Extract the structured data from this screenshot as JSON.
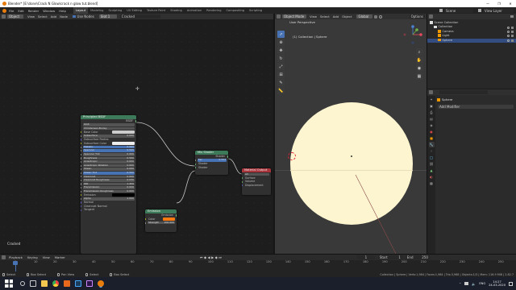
{
  "window": {
    "title": "Blender* [E:\\done\\Crack N Glow\\crack n glow tut.blend]",
    "controls": [
      "—",
      "❐",
      "✕"
    ]
  },
  "topbar": {
    "menus": [
      "File",
      "Edit",
      "Render",
      "Window",
      "Help"
    ],
    "workspaces": [
      "Layout",
      "Modeling",
      "Sculpting",
      "UV Editing",
      "Texture Paint",
      "Shading",
      "Animation",
      "Rendering",
      "Compositing",
      "Scripting"
    ],
    "active_workspace": "Layout",
    "scene": "Scene",
    "view_layer": "View Layer"
  },
  "node_editor": {
    "header": {
      "object_mode": "Object",
      "menus": [
        "View",
        "Select",
        "Add",
        "Node"
      ],
      "use_nodes": "Use Nodes",
      "slot": "Slot 1",
      "material": "Cracked"
    },
    "footer_label": "Cracked",
    "principled": {
      "title": "Principled BSDF",
      "output": "BSDF",
      "distribution": "GGX",
      "subsurface_method": "Christensen-Burley",
      "rows": [
        {
          "label": "Base Color",
          "value": ""
        },
        {
          "label": "Subsurface",
          "value": "0.000"
        },
        {
          "label": "Subsurface Radius",
          "value": ""
        },
        {
          "label": "Subsurface Color",
          "value": ""
        },
        {
          "label": "Metallic",
          "value": "0.000"
        },
        {
          "label": "Specular",
          "value": "0.500"
        },
        {
          "label": "Specular Tint",
          "value": "0.000"
        },
        {
          "label": "Roughness",
          "value": "0.500"
        },
        {
          "label": "Anisotropic",
          "value": "0.000"
        },
        {
          "label": "Anisotropic Rotation",
          "value": "0.000"
        },
        {
          "label": "Sheen",
          "value": "0.000"
        },
        {
          "label": "Sheen Tint",
          "value": "0.500"
        },
        {
          "label": "Clearcoat",
          "value": "0.000"
        },
        {
          "label": "Clearcoat Roughness",
          "value": "0.030"
        },
        {
          "label": "IOR",
          "value": "1.450"
        },
        {
          "label": "Transmission",
          "value": "0.000"
        },
        {
          "label": "Transmission Roughness",
          "value": "0.000"
        },
        {
          "label": "Emission",
          "value": ""
        },
        {
          "label": "Alpha",
          "value": "1.000"
        },
        {
          "label": "Normal",
          "value": ""
        },
        {
          "label": "Clearcoat Normal",
          "value": ""
        },
        {
          "label": "Tangent",
          "value": ""
        }
      ]
    },
    "emission": {
      "title": "Emission",
      "output": "Emission",
      "color_label": "Color",
      "strength_label": "Strength",
      "strength_value": "200.000"
    },
    "mix": {
      "title": "Mix Shader",
      "output": "Shader",
      "fac_label": "Fac",
      "fac_value": "0.554",
      "inputs": [
        "Shader",
        "Shader"
      ]
    },
    "output": {
      "title": "Material Output",
      "target": "All",
      "inputs": [
        "Surface",
        "Volume",
        "Displacement"
      ]
    }
  },
  "viewport": {
    "header": {
      "mode": "Object Mode",
      "menus": [
        "View",
        "Select",
        "Add",
        "Object"
      ],
      "orientation": "Global",
      "options": "Options"
    },
    "overlay_title": "User Perspective",
    "overlay_subtitle": "(1) Collection | Sphere",
    "tools": [
      "cursor",
      "move",
      "rotate",
      "scale",
      "transform",
      "annotate",
      "measure"
    ]
  },
  "outliner": {
    "header_label": "Scene Collection",
    "items": [
      {
        "label": "Scene Collection",
        "indent": 0,
        "icon": "collection-icon",
        "selected": false
      },
      {
        "label": "Collection",
        "indent": 1,
        "icon": "collection-icon",
        "selected": false
      },
      {
        "label": "Camera",
        "indent": 2,
        "icon": "camera-icon",
        "selected": false
      },
      {
        "label": "Light",
        "indent": 2,
        "icon": "light-icon",
        "selected": false
      },
      {
        "label": "Sphere",
        "indent": 2,
        "icon": "mesh-icon",
        "selected": true
      }
    ]
  },
  "properties": {
    "object_name": "Sphere",
    "add_modifier": "Add Modifier"
  },
  "timeline": {
    "menus": [
      "Playback",
      "Keying",
      "View",
      "Marker"
    ],
    "start_label": "Start",
    "start_value": "1",
    "end_label": "End",
    "end_value": "250",
    "current_frame": "1",
    "ticks": [
      "0",
      "10",
      "20",
      "30",
      "40",
      "50",
      "60",
      "70",
      "80",
      "90",
      "100",
      "110",
      "120",
      "130",
      "140",
      "150",
      "160",
      "170",
      "180",
      "190",
      "200",
      "210",
      "220",
      "230",
      "240",
      "250"
    ]
  },
  "statusbar": {
    "left_items": [
      "Select",
      "Box Select",
      "Pan View",
      "Select",
      "Box Select"
    ],
    "stats": "Collection | Sphere | Verts:1,984 | Faces:1,984 | Tris:3,968 | Objects:1/3 | Mem: 116.9 MiB | 2.82.7"
  },
  "taskbar": {
    "lang": "ENG",
    "time": "14:27",
    "date": "24-03-2020"
  },
  "colors": {
    "accent": "#4772b3",
    "node_principled": "#3d7a5a",
    "node_output": "#a8343c",
    "sphere": "#fdf5d0"
  }
}
